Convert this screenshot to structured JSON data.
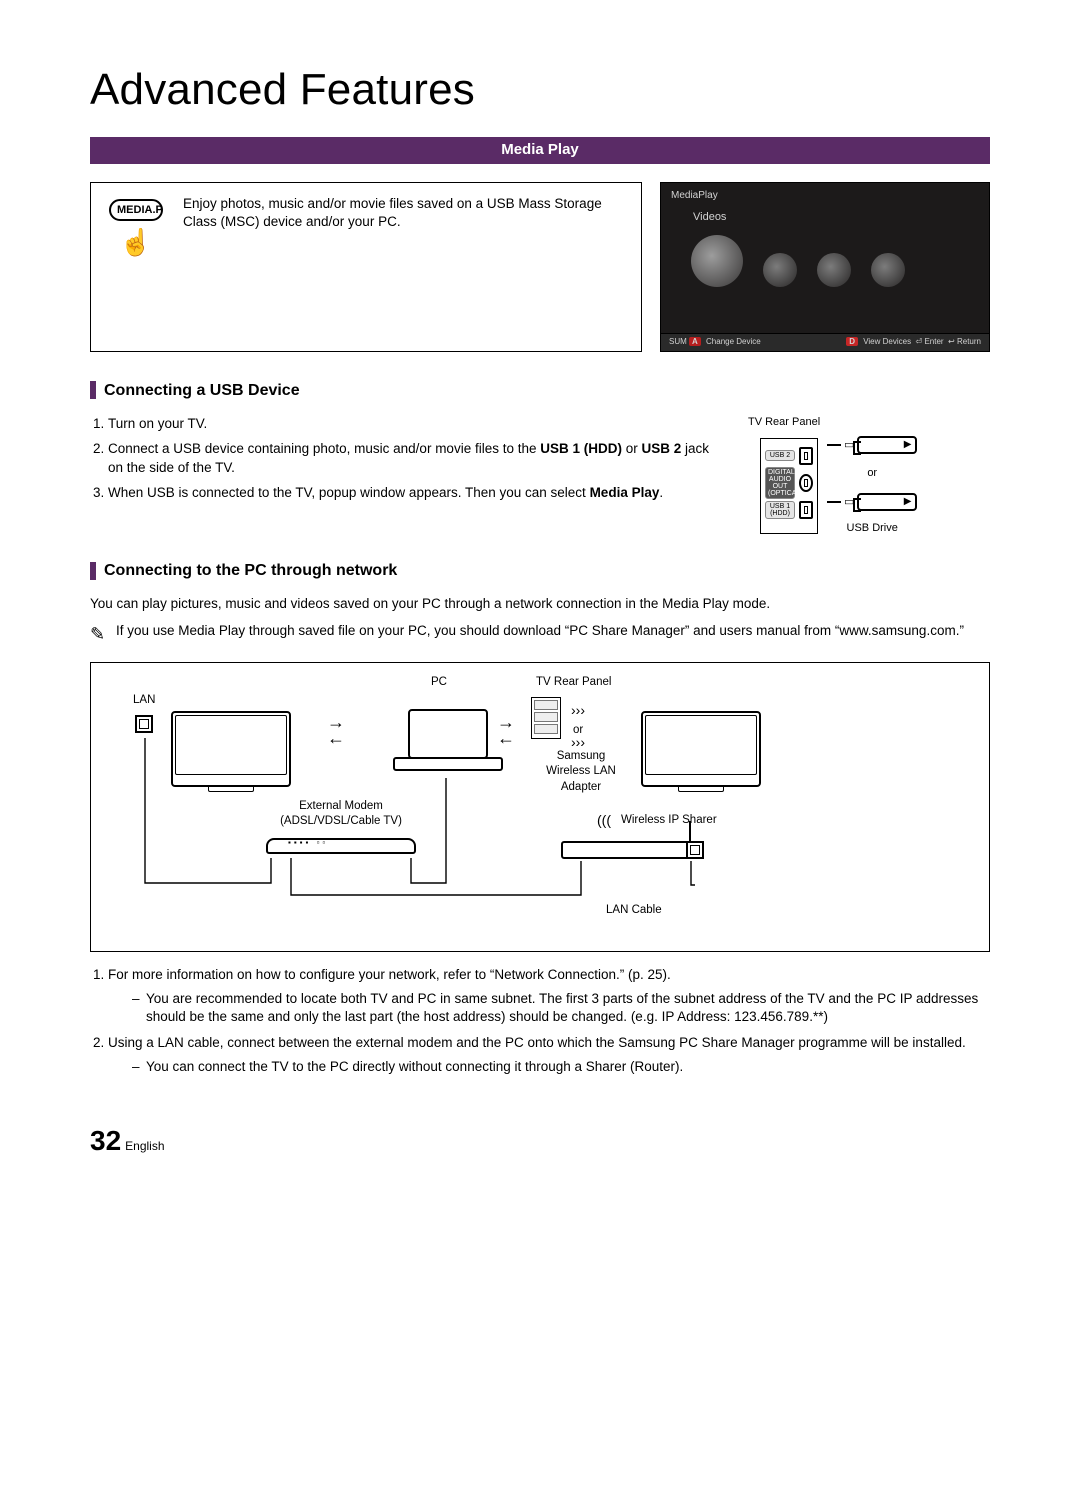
{
  "title": "Advanced Features",
  "bar": "Media Play",
  "intro": {
    "button_label": "MEDIA.P",
    "text": "Enjoy photos, music and/or movie files saved on a USB Mass Storage Class (MSC) device and/or your PC."
  },
  "screenshot": {
    "header": "MediaPlay",
    "category": "Videos",
    "bottom_left_sum": "SUM",
    "bottom_left_a": "A",
    "bottom_left_change": "Change Device",
    "bottom_right_d": "D",
    "bottom_right_view": "View Devices",
    "bottom_right_enter": "Enter",
    "bottom_right_return": "Return"
  },
  "section_usb": {
    "heading": "Connecting a USB Device",
    "steps": [
      {
        "n": "1.",
        "text": "Turn on your TV."
      },
      {
        "n": "2.",
        "pre": "Connect a USB device containing photo, music and/or movie files to the ",
        "b1": "USB 1 (HDD)",
        "mid": " or ",
        "b2": "USB 2",
        "post": " jack on the side of the TV."
      },
      {
        "n": "3.",
        "pre": "When USB is connected to the TV, popup window appears. Then you can select ",
        "b1": "Media Play",
        "post": "."
      }
    ],
    "panel": {
      "rear_label": "TV Rear Panel",
      "usb2": "USB 2",
      "audio": "DIGITAL AUDIO OUT (OPTICAL)",
      "usb1": "USB 1 (HDD)",
      "or": "or",
      "drive": "USB Drive"
    }
  },
  "section_pc": {
    "heading": "Connecting to the PC through network",
    "para_pre": "You can play pictures, music and videos saved on your PC through a network connection in the ",
    "para_bold": "Media Play",
    "para_post": " mode.",
    "note_pre": "If you use ",
    "note_bold": "Media Play",
    "note_post": " through saved file on your PC, you should download “PC Share Manager” and users manual from “www.samsung.com.”",
    "diagram": {
      "lan": "LAN",
      "pc": "PC",
      "rear": "TV Rear Panel",
      "or": "or",
      "adapter": "Samsung Wireless LAN Adapter",
      "modem": "External Modem (ADSL/VDSL/Cable TV)",
      "sharer": "Wireless IP Sharer",
      "cable": "LAN Cable"
    },
    "steps2": [
      {
        "n": "1.",
        "text": "For more information on how to configure your network, refer to “Network Connection.” (p. 25).",
        "sub": [
          "You are recommended to locate both TV and PC in same subnet. The first 3 parts of the subnet address of the TV and the PC IP addresses should be the same and only the last part (the host address) should be changed. (e.g. IP Address: 123.456.789.**)"
        ]
      },
      {
        "n": "2.",
        "text": "Using a LAN cable, connect between the external modem and the PC onto which the Samsung PC Share Manager programme will be installed.",
        "sub": [
          "You can connect the TV to the PC directly without connecting it through a Sharer (Router)."
        ]
      }
    ]
  },
  "footer": {
    "page": "32",
    "lang": "English"
  }
}
